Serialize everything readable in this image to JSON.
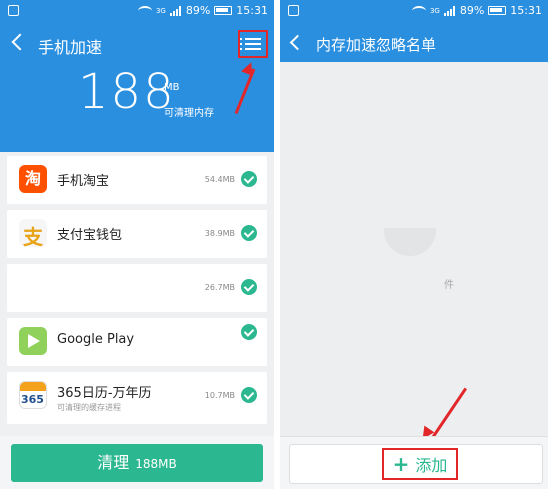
{
  "status": {
    "network": "3G",
    "battery": "89%",
    "time": "15:31"
  },
  "left": {
    "title": "手机加速",
    "cleanable": {
      "amount": "188",
      "unit": "MB",
      "label": "可清理内存"
    },
    "apps": [
      {
        "name": "手机淘宝",
        "size": "54.4MB",
        "sub": "",
        "icon_text": "淘"
      },
      {
        "name": "支付宝钱包",
        "size": "38.9MB",
        "sub": "",
        "icon_text": "支"
      },
      {
        "name": "",
        "size": "26.7MB",
        "sub": ""
      },
      {
        "name": "Google Play",
        "size": "",
        "sub": ""
      },
      {
        "name": "365日历-万年历",
        "size": "10.7MB",
        "sub": "可清理的缓存进程",
        "icon_text": "365"
      }
    ],
    "clean_button": {
      "label": "清理",
      "amount": "188MB"
    }
  },
  "right": {
    "title": "内存加速忽略名单",
    "empty_text": "件",
    "add_button": {
      "label": "添加",
      "icon": "plus-icon"
    }
  },
  "colors": {
    "header_blue": "#2b8fe0",
    "accent_green": "#2bb78f",
    "highlight_red": "#e2272b"
  }
}
